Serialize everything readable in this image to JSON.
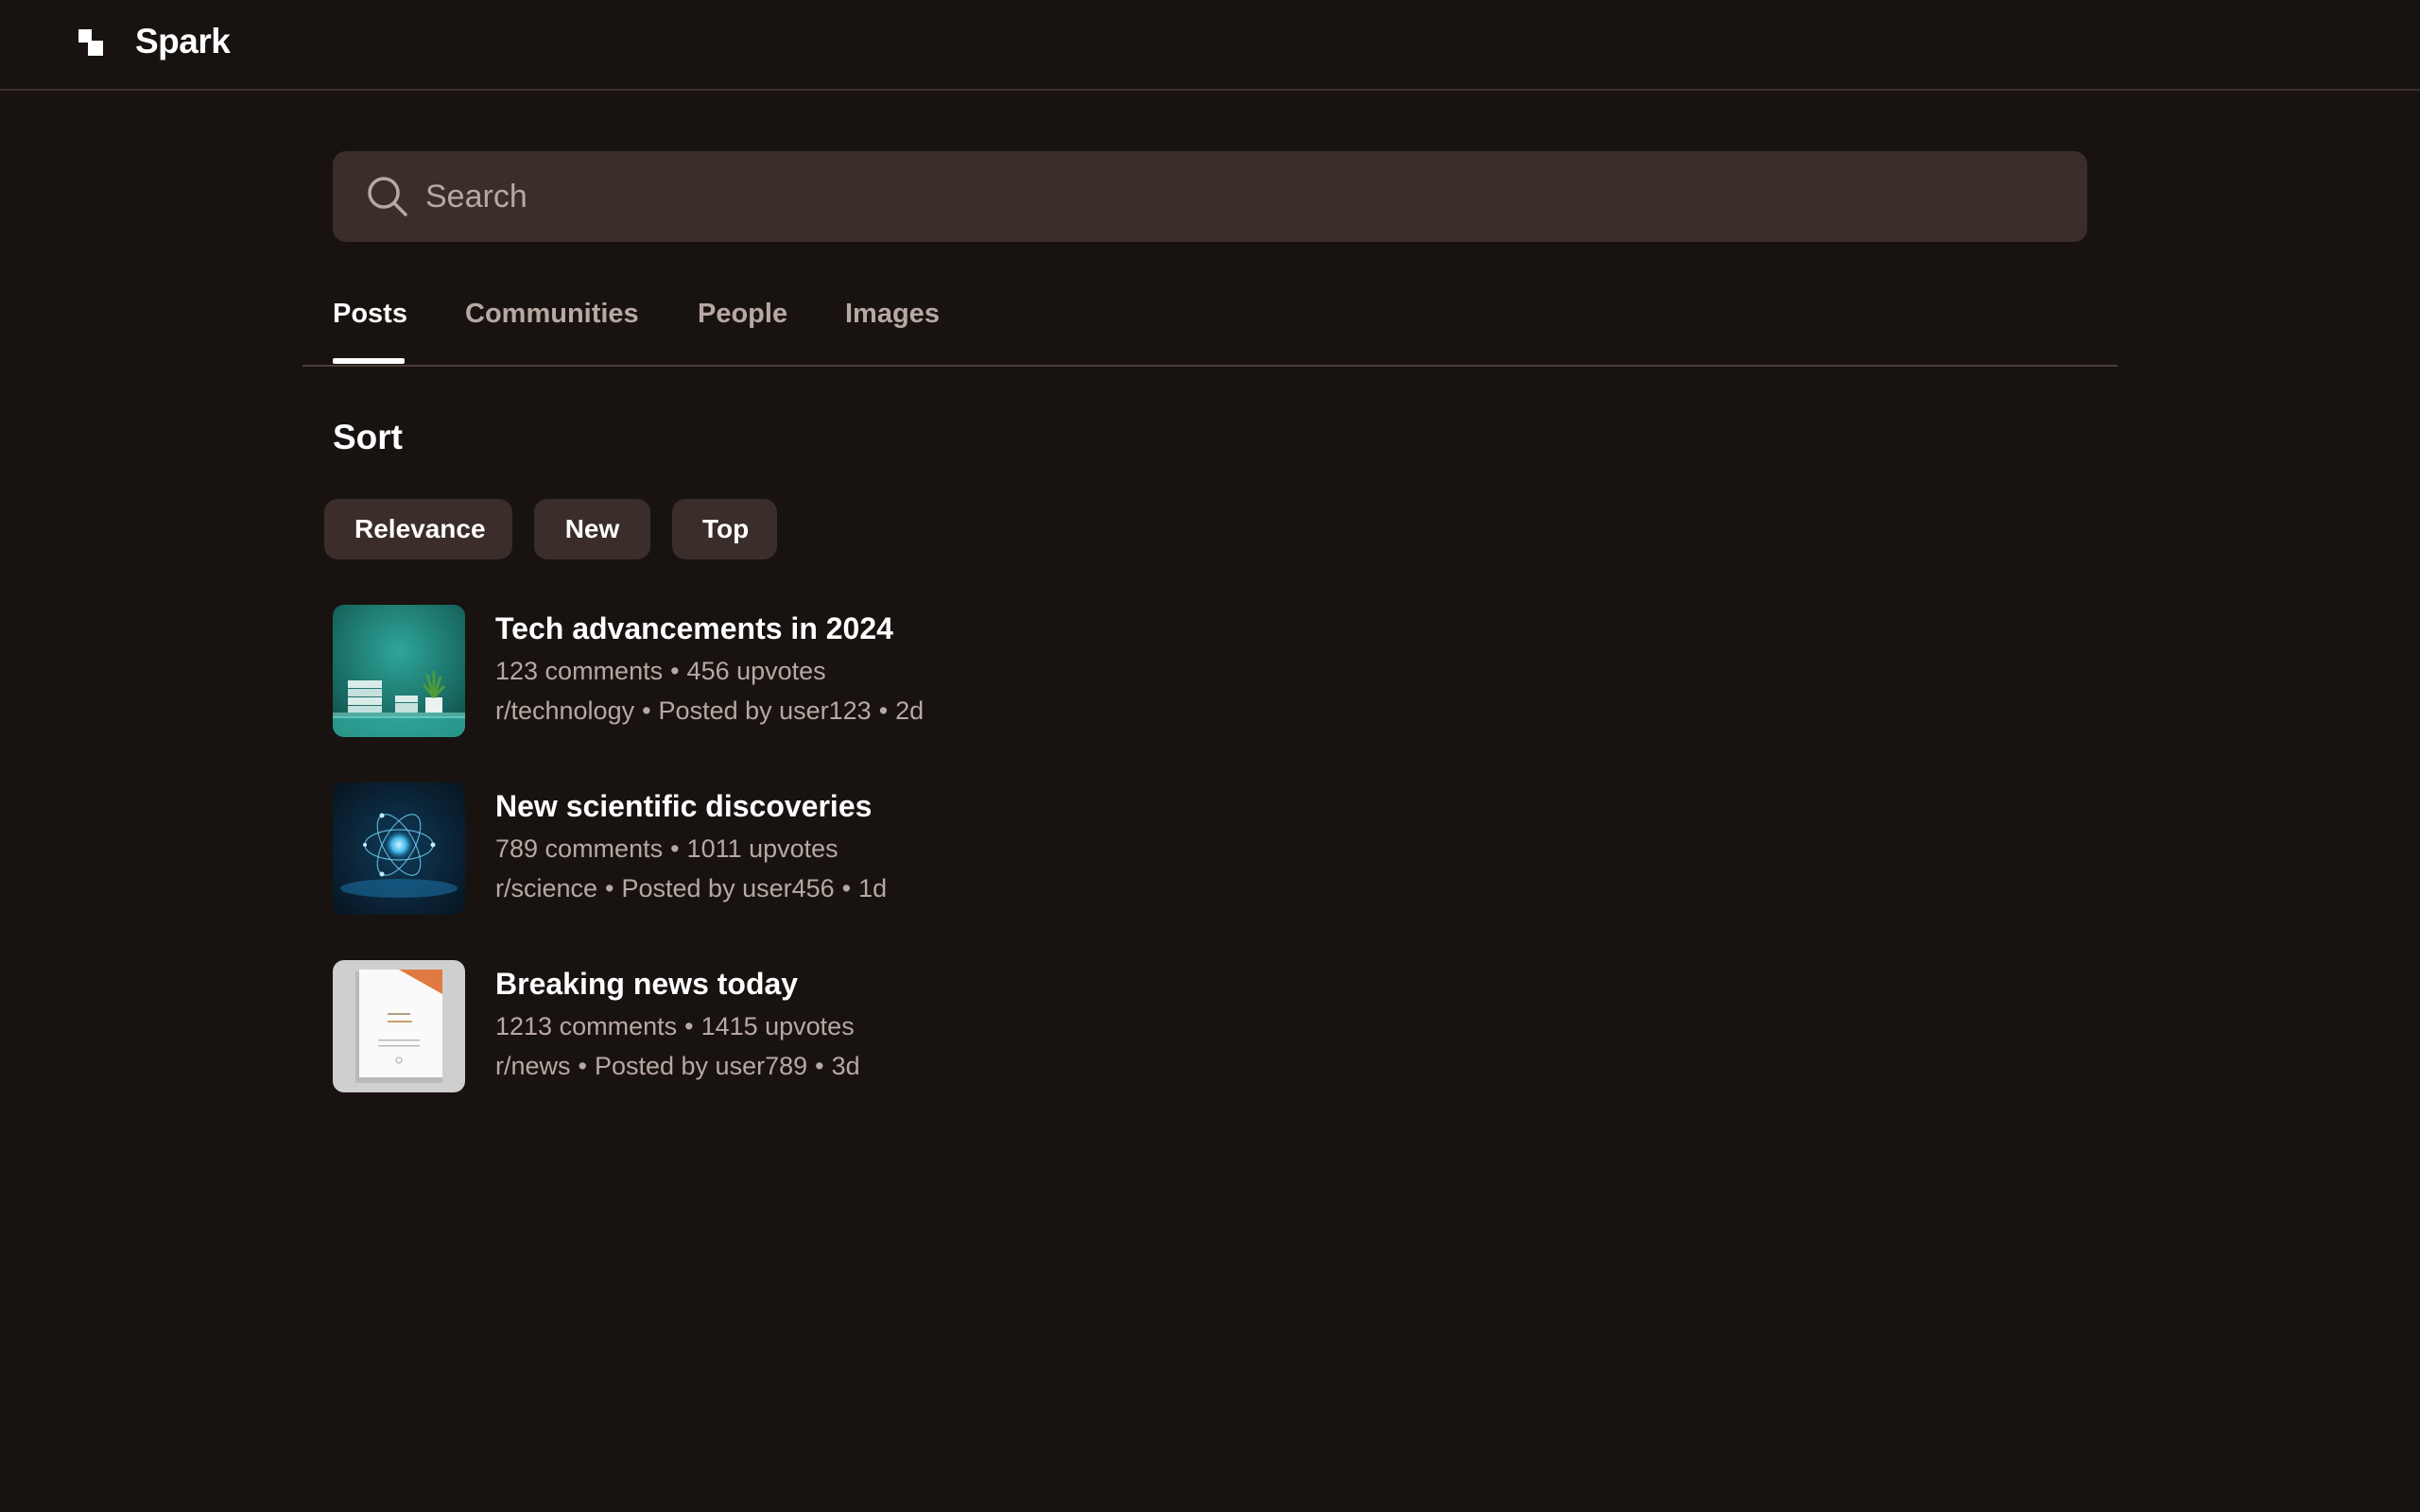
{
  "app": {
    "brand": "Spark",
    "logo_icon": "spark-logo-icon"
  },
  "search": {
    "placeholder": "Search",
    "value": "",
    "icon": "search-icon"
  },
  "tabs": [
    {
      "label": "Posts",
      "active": true
    },
    {
      "label": "Communities",
      "active": false
    },
    {
      "label": "People",
      "active": false
    },
    {
      "label": "Images",
      "active": false
    }
  ],
  "sort": {
    "heading": "Sort",
    "options": [
      "Relevance",
      "New",
      "Top"
    ]
  },
  "results": [
    {
      "title": "Tech advancements in 2024",
      "comments": "123 comments",
      "upvotes": "456 upvotes",
      "community": "r/technology",
      "posted_by": "Posted by user123",
      "age": "2d",
      "thumbnail": "tech-desk-thumbnail"
    },
    {
      "title": "New scientific discoveries",
      "comments": "789 comments",
      "upvotes": "1011 upvotes",
      "community": "r/science",
      "posted_by": "Posted by user456",
      "age": "1d",
      "thumbnail": "atom-thumbnail"
    },
    {
      "title": "Breaking news today",
      "comments": "1213 comments",
      "upvotes": "1415 upvotes",
      "community": "r/news",
      "posted_by": "Posted by user789",
      "age": "3d",
      "thumbnail": "newspaper-thumbnail"
    }
  ],
  "colors": {
    "background": "#181311",
    "surface": "#3a2d2a",
    "text_primary": "#ffffff",
    "text_secondary": "#b8a8a2"
  },
  "separator": "•"
}
